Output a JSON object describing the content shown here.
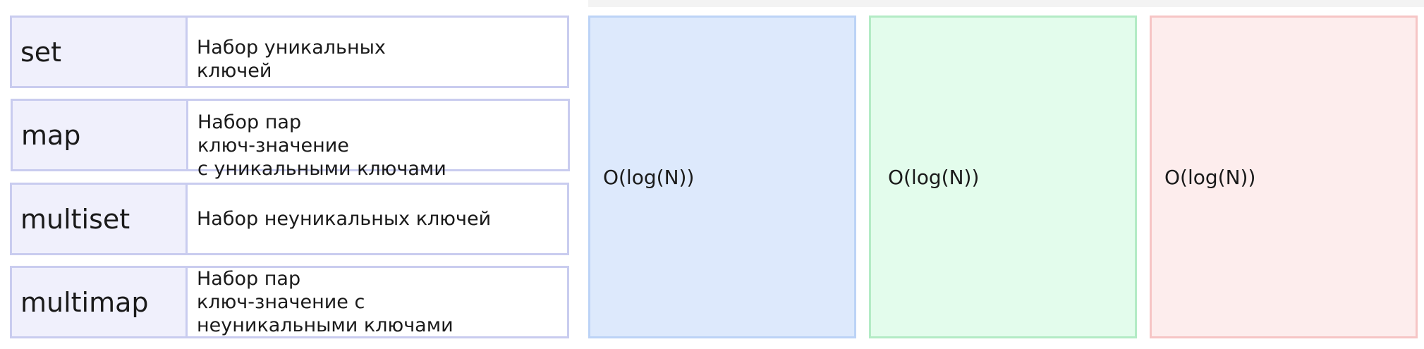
{
  "containers": [
    {
      "name": "set",
      "description": "Набор уникальных\nключей"
    },
    {
      "name": "map",
      "description": "Набор пар\nключ-значение\nс уникальными ключами"
    },
    {
      "name": "multiset",
      "description": "Набор неуникальных ключей"
    },
    {
      "name": "multimap",
      "description": "Набор пар\nключ-значение с\nнеуникальными ключами"
    }
  ],
  "complexity_panels": [
    {
      "label": "O(log(N))",
      "color": "#dde9fc"
    },
    {
      "label": "O(log(N))",
      "color": "#e3fcec"
    },
    {
      "label": "O(log(N))",
      "color": "#fdeded"
    }
  ]
}
